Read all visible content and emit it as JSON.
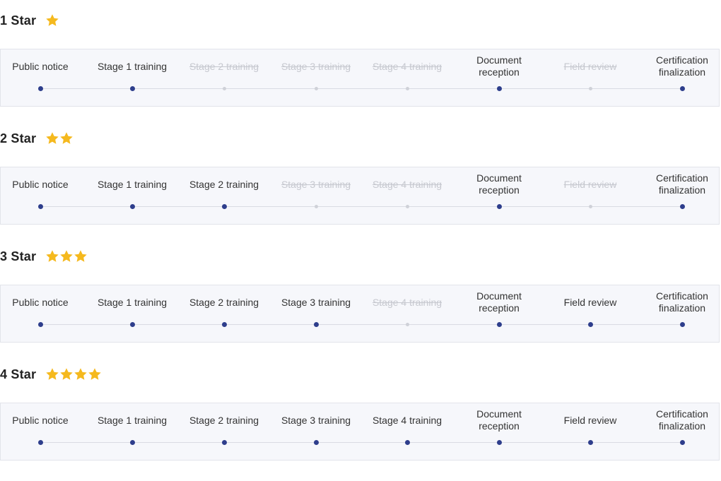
{
  "colors": {
    "active_dot": "#2e3e8c",
    "inactive_dot": "#cfd1d8",
    "inactive_text": "#c6c8cf",
    "star": "#f5b91e",
    "panel_bg": "#f6f7fb",
    "panel_border": "#e2e4ea"
  },
  "tiers": [
    {
      "title": "1 Star",
      "star_count": 1,
      "steps": [
        {
          "label": "Public notice",
          "active": true
        },
        {
          "label": "Stage 1 training",
          "active": true
        },
        {
          "label": "Stage 2 training",
          "active": false
        },
        {
          "label": "Stage 3 training",
          "active": false
        },
        {
          "label": "Stage 4 training",
          "active": false
        },
        {
          "label": "Document reception",
          "active": true
        },
        {
          "label": "Field review",
          "active": false
        },
        {
          "label": "Certification finalization",
          "active": true
        }
      ]
    },
    {
      "title": "2 Star",
      "star_count": 2,
      "steps": [
        {
          "label": "Public notice",
          "active": true
        },
        {
          "label": "Stage 1 training",
          "active": true
        },
        {
          "label": "Stage 2 training",
          "active": true
        },
        {
          "label": "Stage 3 training",
          "active": false
        },
        {
          "label": "Stage 4 training",
          "active": false
        },
        {
          "label": "Document reception",
          "active": true
        },
        {
          "label": "Field review",
          "active": false
        },
        {
          "label": "Certification finalization",
          "active": true
        }
      ]
    },
    {
      "title": "3 Star",
      "star_count": 3,
      "steps": [
        {
          "label": "Public notice",
          "active": true
        },
        {
          "label": "Stage 1 training",
          "active": true
        },
        {
          "label": "Stage 2 training",
          "active": true
        },
        {
          "label": "Stage 3 training",
          "active": true
        },
        {
          "label": "Stage 4 training",
          "active": false
        },
        {
          "label": "Document reception",
          "active": true
        },
        {
          "label": "Field review",
          "active": true
        },
        {
          "label": "Certification finalization",
          "active": true
        }
      ]
    },
    {
      "title": "4 Star",
      "star_count": 4,
      "steps": [
        {
          "label": "Public notice",
          "active": true
        },
        {
          "label": "Stage 1 training",
          "active": true
        },
        {
          "label": "Stage 2 training",
          "active": true
        },
        {
          "label": "Stage 3 training",
          "active": true
        },
        {
          "label": "Stage 4 training",
          "active": true
        },
        {
          "label": "Document reception",
          "active": true
        },
        {
          "label": "Field review",
          "active": true
        },
        {
          "label": "Certification finalization",
          "active": true
        }
      ]
    }
  ]
}
